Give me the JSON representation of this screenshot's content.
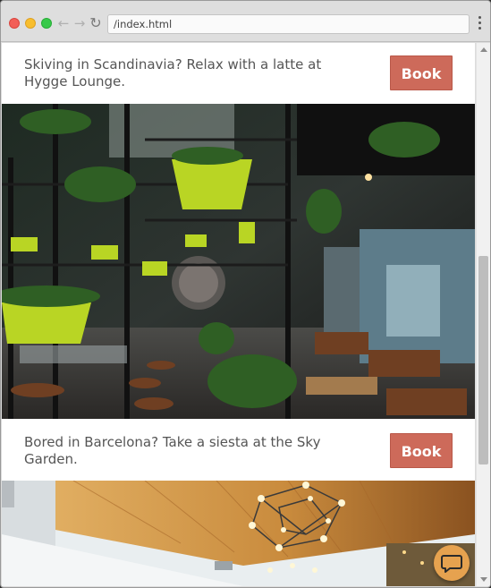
{
  "browser": {
    "url": "/index.html",
    "back_icon": "←",
    "forward_icon": "→",
    "reload_icon": "↻"
  },
  "promos": [
    {
      "text": "Skiving in Scandinavia? Relax with a latte at Hygge Lounge.",
      "button_label": "Book"
    },
    {
      "text": "Bored in Barcelona? Take a siesta at the Sky Garden.",
      "button_label": "Book"
    }
  ],
  "colors": {
    "book_button": "#cd6a5a",
    "chat_button": "#e6a24f"
  },
  "icons": {
    "chat": "chat-bubble-icon"
  }
}
